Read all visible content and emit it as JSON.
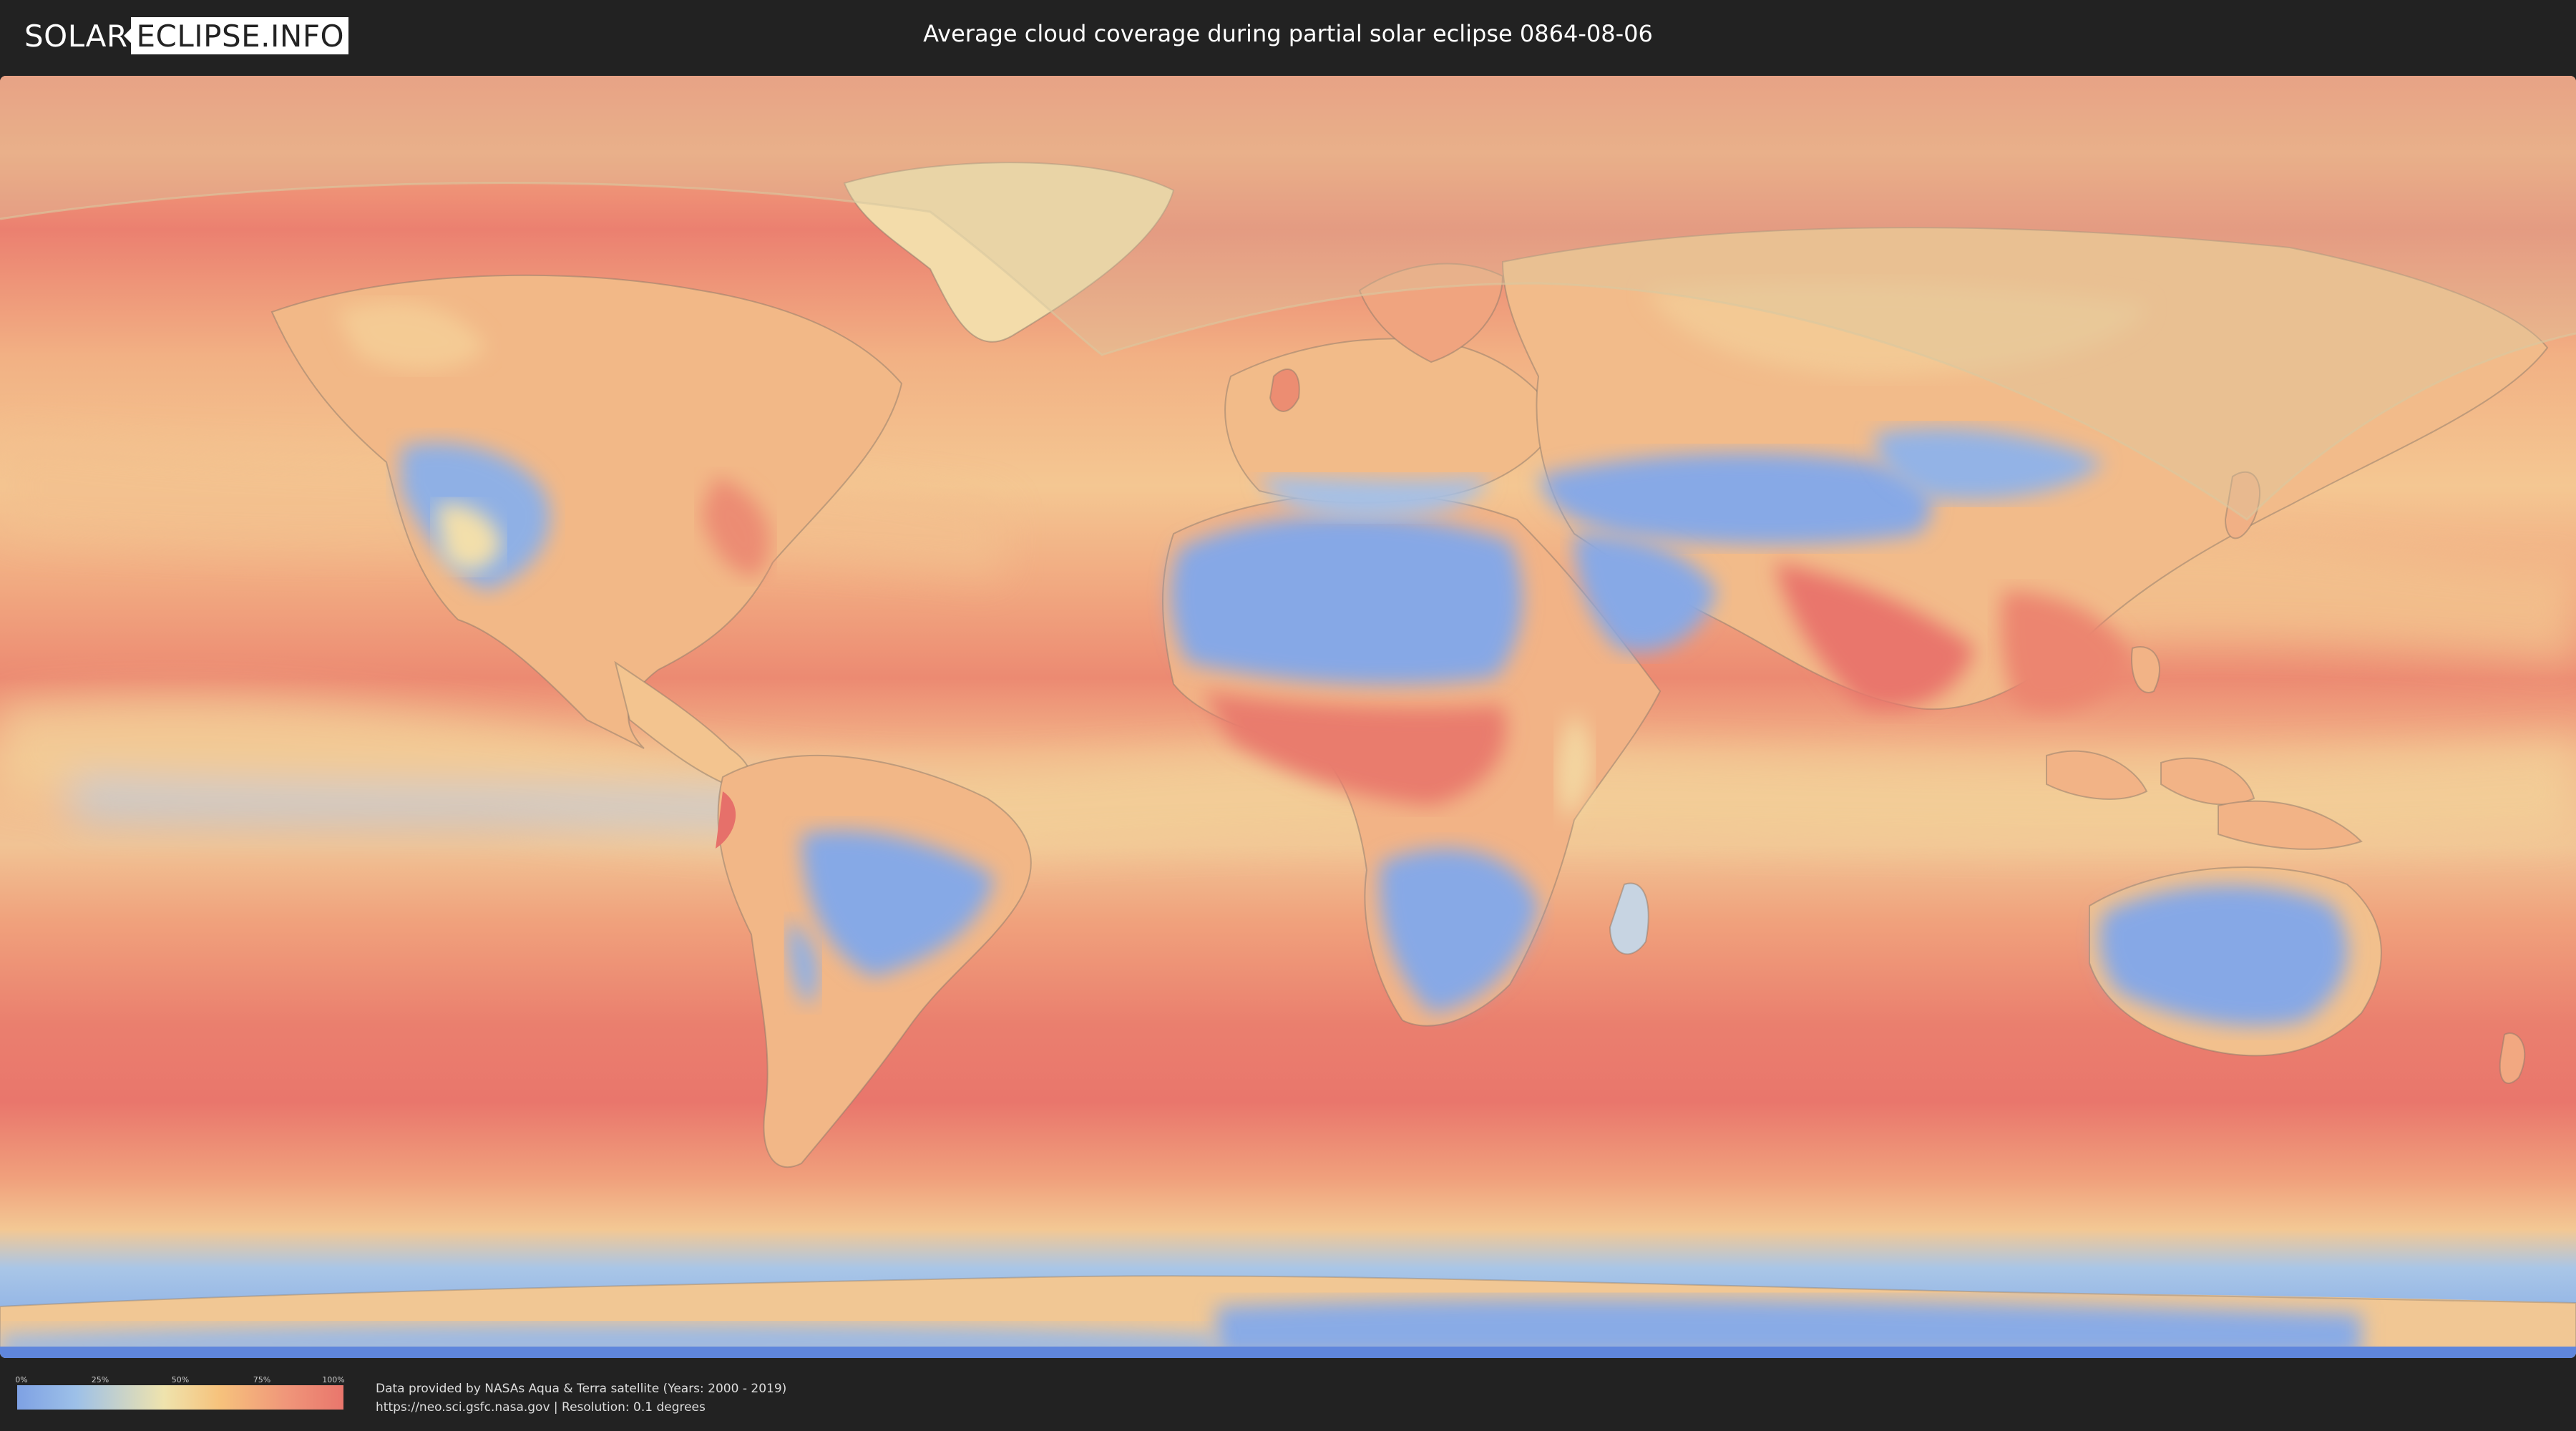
{
  "header": {
    "logo_left": "SOLAR",
    "logo_right": "ECLIPSE.INFO",
    "title": "Average cloud coverage during partial solar eclipse 0864-08-06"
  },
  "map": {
    "type": "cloud-coverage-world-map",
    "projection": "equirectangular",
    "eclipse_shadow_overlay": true
  },
  "legend": {
    "ticks": [
      "0%",
      "25%",
      "50%",
      "75%",
      "100%"
    ],
    "scale_colors": [
      "#7ea1e4",
      "#9dc0e8",
      "#efe3ad",
      "#f6c27c",
      "#f0977a",
      "#e9766c"
    ]
  },
  "credits": {
    "line1": "Data provided by NASAs Aqua & Terra satellite (Years: 2000 - 2019)",
    "line2": "https://neo.sci.gsfc.nasa.gov | Resolution: 0.1 degrees"
  },
  "colors": {
    "background": "#222222",
    "ocean_cloudy": "#e9866f",
    "clear_sky": "#7ea1e4",
    "mid": "#f3d9a3"
  }
}
